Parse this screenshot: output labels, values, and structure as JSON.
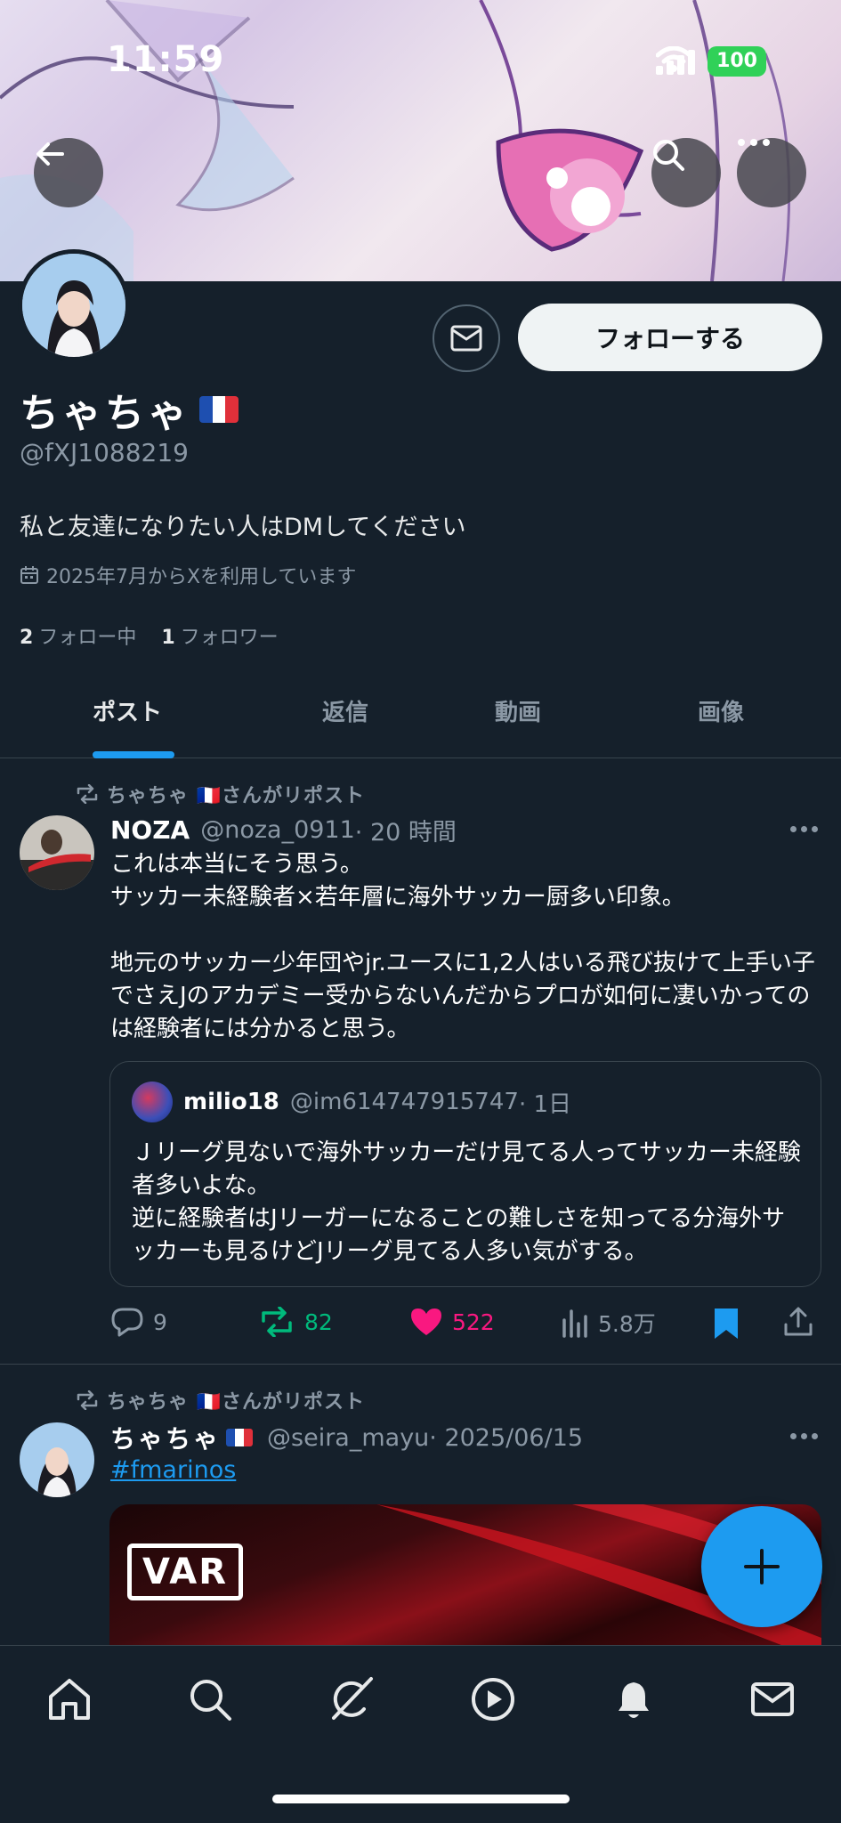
{
  "status_bar": {
    "time": "11:59",
    "battery": "100"
  },
  "profile": {
    "display_name": "ちゃちゃ",
    "flag": "🇫🇷",
    "handle": "@fXJ1088219",
    "bio": "私と友達になりたい人はDMしてください",
    "joined": "2025年7月からXを利用しています",
    "following_count": "2",
    "following_label": "フォロー中",
    "followers_count": "1",
    "followers_label": "フォロワー",
    "follow_button": "フォローする"
  },
  "tabs": [
    {
      "label": "ポスト",
      "active": true
    },
    {
      "label": "返信",
      "active": false
    },
    {
      "label": "動画",
      "active": false
    },
    {
      "label": "画像",
      "active": false
    }
  ],
  "posts": [
    {
      "repost_label": "ちゃちゃ 🇫🇷さんがリポスト",
      "author": "NOZA",
      "handle": "@noza_0911",
      "time": "· 20 時間",
      "text": "これは本当にそう思う。\nサッカー未経験者×若年層に海外サッカー厨多い印象。\n\n地元のサッカー少年団やjr.ユースに1,2人はいる飛び抜けて上手い子でさえJのアカデミー受からないんだからプロが如何に凄いかってのは経験者には分かると思う。",
      "quote": {
        "author": "milio18",
        "handle": "@im614747915747",
        "time": "· 1日",
        "text": "Ｊリーグ見ないで海外サッカーだけ見てる人ってサッカー未経験者多いよな。\n逆に経験者はJリーガーになることの難しさを知ってる分海外サッカーも見るけどJリーグ見てる人多い気がする。"
      },
      "stats": {
        "replies": "9",
        "reposts": "82",
        "likes": "522",
        "views": "5.8万"
      },
      "colors": {
        "repost": "#00ba7c",
        "like": "#f91880",
        "bookmark": "#1d9bf0"
      }
    },
    {
      "repost_label": "ちゃちゃ 🇫🇷さんがリポスト",
      "author": "ちゃちゃ",
      "author_flag": "🇫🇷",
      "handle": "@seira_mayu",
      "time": "· 2025/06/15",
      "hashtag": "#fmarinos",
      "media_label": "VAR"
    }
  ],
  "bottom_nav": [
    "home-icon",
    "search-icon",
    "grok-icon",
    "video-icon",
    "notifications-icon",
    "messages-icon"
  ],
  "accent": "#1d9bf0"
}
